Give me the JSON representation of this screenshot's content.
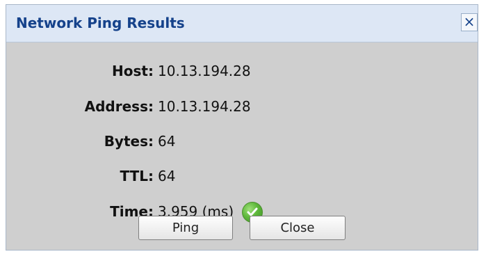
{
  "dialog": {
    "title": "Network Ping Results",
    "close_icon": "close-icon"
  },
  "rows": [
    {
      "label": "Host:",
      "value": "10.13.194.28"
    },
    {
      "label": "Address:",
      "value": "10.13.194.28"
    },
    {
      "label": "Bytes:",
      "value": "64"
    },
    {
      "label": "TTL:",
      "value": "64"
    },
    {
      "label": "Time:",
      "value": "3.959 (ms)"
    }
  ],
  "status_icon": "checkmark-icon",
  "buttons": {
    "ping_label": "Ping",
    "close_label": "Close"
  },
  "colors": {
    "title": "#15428b",
    "titlebar_bg": "#dde7f5",
    "content_bg": "#cfcfcf",
    "success": "#5eb83b"
  }
}
